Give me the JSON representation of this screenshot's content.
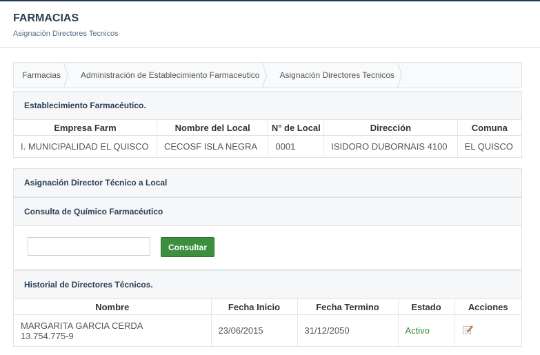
{
  "header": {
    "title": "FARMACIAS",
    "subtitle": "Asignación Directores Tecnicos"
  },
  "breadcrumb": [
    {
      "label": "Farmacias"
    },
    {
      "label": "Administración de Establecimiento Farmaceutico"
    },
    {
      "label": "Asignación Directores Tecnicos"
    }
  ],
  "establecimiento": {
    "title": "Establecimiento Farmacéutico.",
    "columns": [
      "Empresa Farm",
      "Nombre del Local",
      "N° de Local",
      "Dirección",
      "Comuna"
    ],
    "row": [
      "I. MUNICIPALIDAD EL QUISCO",
      "CECOSF ISLA NEGRA",
      "0001",
      "ISIDORO DUBORNAIS 4100",
      "EL QUISCO"
    ]
  },
  "asignacion": {
    "title": "Asignación Director Técnico a Local"
  },
  "consulta": {
    "title": "Consulta de Químico Farmacéutico",
    "input_value": "",
    "button_label": "Consultar"
  },
  "historial": {
    "title": "Historial de Directores Técnicos.",
    "columns": [
      "Nombre",
      "Fecha Inicio",
      "Fecha Termino",
      "Estado",
      "Acciones"
    ],
    "rows": [
      {
        "nombre": "MARGARITA GARCIA CERDA",
        "rut": "13.754.775-9",
        "fecha_inicio": "23/06/2015",
        "fecha_termino": "31/12/2050",
        "estado": "Activo",
        "accion_icon": "edit-icon"
      }
    ]
  },
  "colors": {
    "header_text": "#2a3f54",
    "button_green": "#3c8f3f",
    "estado_activo": "#2f8a2f"
  }
}
